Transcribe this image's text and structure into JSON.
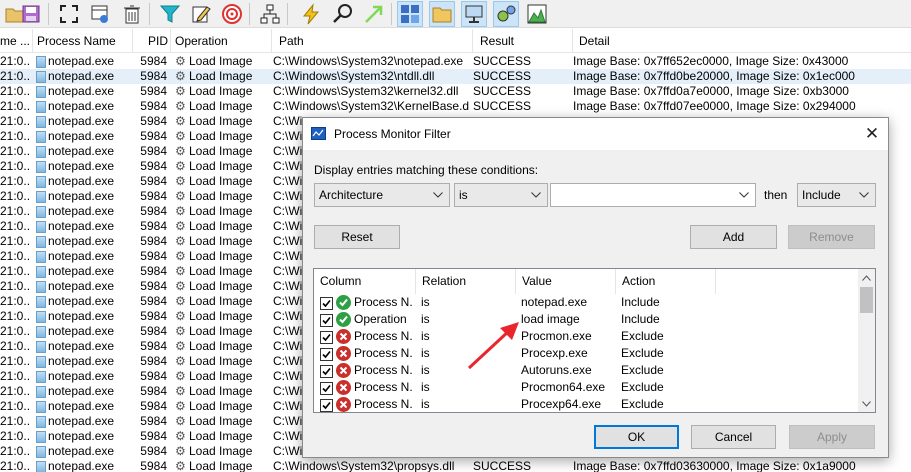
{
  "toolbar": {
    "icons": [
      "open-icon",
      "save-icon",
      "capture-icon",
      "autoscroll-icon",
      "clear-icon",
      "filter-icon",
      "highlight-icon",
      "include-process-icon",
      "tree-icon",
      "jump-icon",
      "find-icon",
      "jump-to-object-icon",
      "registry-activity-icon",
      "filesystem-activity-icon",
      "network-activity-icon",
      "process-activity-icon",
      "profiling-events-icon"
    ]
  },
  "list": {
    "columns": [
      "me ...",
      "Process Name",
      "PID",
      "Operation",
      "Path",
      "Result",
      "Detail"
    ],
    "rows": [
      {
        "time": "21:0...",
        "process": "notepad.exe",
        "pid": "5984",
        "operation": "Load Image",
        "path": "C:\\Windows\\System32\\notepad.exe",
        "result": "SUCCESS",
        "detail": "Image Base: 0x7ff652ec0000, Image Size: 0x43000"
      },
      {
        "time": "21:0...",
        "process": "notepad.exe",
        "pid": "5984",
        "operation": "Load Image",
        "path": "C:\\Windows\\System32\\ntdll.dll",
        "result": "SUCCESS",
        "detail": "Image Base: 0x7ffd0be20000, Image Size: 0x1ec000"
      },
      {
        "time": "21:0...",
        "process": "notepad.exe",
        "pid": "5984",
        "operation": "Load Image",
        "path": "C:\\Windows\\System32\\kernel32.dll",
        "result": "SUCCESS",
        "detail": "Image Base: 0x7ffd0a7e0000, Image Size: 0xb3000"
      },
      {
        "time": "21:0...",
        "process": "notepad.exe",
        "pid": "5984",
        "operation": "Load Image",
        "path": "C:\\Windows\\System32\\KernelBase.dll",
        "result": "SUCCESS",
        "detail": "Image Base: 0x7ffd07ee0000, Image Size: 0x294000"
      },
      {
        "time": "21:0...",
        "process": "notepad.exe",
        "pid": "5984",
        "operation": "Load Image",
        "path": "C:\\Wi",
        "result": "",
        "detail": ""
      },
      {
        "time": "21:0...",
        "process": "notepad.exe",
        "pid": "5984",
        "operation": "Load Image",
        "path": "C:\\Wi",
        "result": "",
        "detail": ""
      },
      {
        "time": "21:0...",
        "process": "notepad.exe",
        "pid": "5984",
        "operation": "Load Image",
        "path": "C:\\Wi",
        "result": "",
        "detail": ""
      },
      {
        "time": "21:0...",
        "process": "notepad.exe",
        "pid": "5984",
        "operation": "Load Image",
        "path": "C:\\Wi",
        "result": "",
        "detail": ""
      },
      {
        "time": "21:0...",
        "process": "notepad.exe",
        "pid": "5984",
        "operation": "Load Image",
        "path": "C:\\Wi",
        "result": "",
        "detail": ""
      },
      {
        "time": "21:0...",
        "process": "notepad.exe",
        "pid": "5984",
        "operation": "Load Image",
        "path": "C:\\Wi",
        "result": "",
        "detail": ""
      },
      {
        "time": "21:0...",
        "process": "notepad.exe",
        "pid": "5984",
        "operation": "Load Image",
        "path": "C:\\Wi",
        "result": "",
        "detail": ""
      },
      {
        "time": "21:0...",
        "process": "notepad.exe",
        "pid": "5984",
        "operation": "Load Image",
        "path": "C:\\Wi",
        "result": "",
        "detail": ""
      },
      {
        "time": "21:0...",
        "process": "notepad.exe",
        "pid": "5984",
        "operation": "Load Image",
        "path": "C:\\Wi",
        "result": "",
        "detail": ""
      },
      {
        "time": "21:0...",
        "process": "notepad.exe",
        "pid": "5984",
        "operation": "Load Image",
        "path": "C:\\Wi",
        "result": "",
        "detail": ""
      },
      {
        "time": "21:0...",
        "process": "notepad.exe",
        "pid": "5984",
        "operation": "Load Image",
        "path": "C:\\Wi",
        "result": "",
        "detail": ""
      },
      {
        "time": "21:0...",
        "process": "notepad.exe",
        "pid": "5984",
        "operation": "Load Image",
        "path": "C:\\Wi",
        "result": "",
        "detail": ""
      },
      {
        "time": "21:0...",
        "process": "notepad.exe",
        "pid": "5984",
        "operation": "Load Image",
        "path": "C:\\Wi",
        "result": "",
        "detail": ""
      },
      {
        "time": "21:0...",
        "process": "notepad.exe",
        "pid": "5984",
        "operation": "Load Image",
        "path": "C:\\Wi",
        "result": "",
        "detail": ""
      },
      {
        "time": "21:0...",
        "process": "notepad.exe",
        "pid": "5984",
        "operation": "Load Image",
        "path": "C:\\Wi",
        "result": "",
        "detail": ""
      },
      {
        "time": "21:0...",
        "process": "notepad.exe",
        "pid": "5984",
        "operation": "Load Image",
        "path": "C:\\Wi",
        "result": "",
        "detail": ""
      },
      {
        "time": "21:0...",
        "process": "notepad.exe",
        "pid": "5984",
        "operation": "Load Image",
        "path": "C:\\Wi",
        "result": "",
        "detail": ""
      },
      {
        "time": "21:0...",
        "process": "notepad.exe",
        "pid": "5984",
        "operation": "Load Image",
        "path": "C:\\Wi",
        "result": "",
        "detail": ""
      },
      {
        "time": "21:0...",
        "process": "notepad.exe",
        "pid": "5984",
        "operation": "Load Image",
        "path": "C:\\Wi",
        "result": "",
        "detail": ""
      },
      {
        "time": "21:0...",
        "process": "notepad.exe",
        "pid": "5984",
        "operation": "Load Image",
        "path": "C:\\Wi",
        "result": "",
        "detail": ""
      },
      {
        "time": "21:0...",
        "process": "notepad.exe",
        "pid": "5984",
        "operation": "Load Image",
        "path": "C:\\Wi",
        "result": "",
        "detail": ""
      },
      {
        "time": "21:0...",
        "process": "notepad.exe",
        "pid": "5984",
        "operation": "Load Image",
        "path": "C:\\Wi",
        "result": "",
        "detail": ""
      },
      {
        "time": "21:0...",
        "process": "notepad.exe",
        "pid": "5984",
        "operation": "Load Image",
        "path": "C:\\Wi",
        "result": "",
        "detail": ""
      },
      {
        "time": "21:0...",
        "process": "notepad.exe",
        "pid": "5984",
        "operation": "Load Image",
        "path": "C:\\Windows\\System32\\propsys.dll",
        "result": "SUCCESS",
        "detail": "Image Base: 0x7ffd03630000, Image Size: 0x1a9000"
      }
    ]
  },
  "dialog": {
    "title": "Process Monitor Filter",
    "close_glyph": "✕",
    "condition_label": "Display entries matching these conditions:",
    "column_value": "Architecture",
    "relation_value": "is",
    "value_text": "",
    "then_label": "then",
    "action_value": "Include",
    "reset_label": "Reset",
    "add_label": "Add",
    "remove_label": "Remove",
    "list_headers": [
      "Column",
      "Relation",
      "Value",
      "Action"
    ],
    "filters": [
      {
        "checked": true,
        "type": "include",
        "column": "Process N...",
        "relation": "is",
        "value": "notepad.exe",
        "action": "Include"
      },
      {
        "checked": true,
        "type": "include",
        "column": "Operation",
        "relation": "is",
        "value": "load image",
        "action": "Include"
      },
      {
        "checked": true,
        "type": "exclude",
        "column": "Process N...",
        "relation": "is",
        "value": "Procmon.exe",
        "action": "Exclude"
      },
      {
        "checked": true,
        "type": "exclude",
        "column": "Process N...",
        "relation": "is",
        "value": "Procexp.exe",
        "action": "Exclude"
      },
      {
        "checked": true,
        "type": "exclude",
        "column": "Process N...",
        "relation": "is",
        "value": "Autoruns.exe",
        "action": "Exclude"
      },
      {
        "checked": true,
        "type": "exclude",
        "column": "Process N...",
        "relation": "is",
        "value": "Procmon64.exe",
        "action": "Exclude"
      },
      {
        "checked": true,
        "type": "exclude",
        "column": "Process N...",
        "relation": "is",
        "value": "Procexp64.exe",
        "action": "Exclude"
      }
    ],
    "ok_label": "OK",
    "cancel_label": "Cancel",
    "apply_label": "Apply"
  },
  "colors": {
    "include": "#2ea043",
    "exclude": "#c9302c",
    "annotation_arrow": "#e8262b",
    "selection": "#e5eff9"
  }
}
